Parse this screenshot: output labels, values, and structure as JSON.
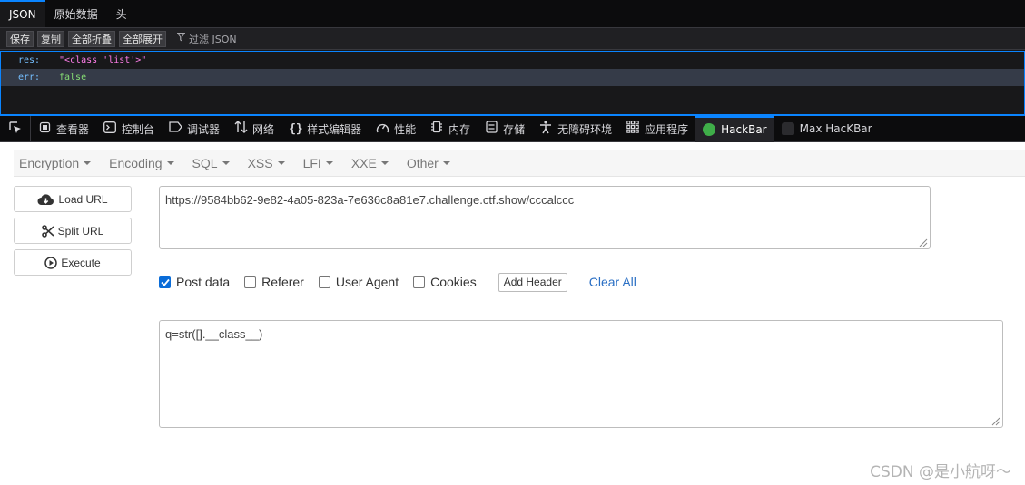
{
  "json_viewer": {
    "tabs": [
      "JSON",
      "原始数据",
      "头"
    ],
    "toolbar": [
      "保存",
      "复制",
      "全部折叠",
      "全部展开"
    ],
    "filter_placeholder": "过滤 JSON",
    "rows": [
      {
        "key": "res:",
        "value": "\"<class 'list'>\"",
        "type": "string"
      },
      {
        "key": "err:",
        "value": "false",
        "type": "boolean"
      }
    ]
  },
  "devtools": {
    "tabs": [
      {
        "label": "查看器",
        "icon": "inspector-icon"
      },
      {
        "label": "控制台",
        "icon": "console-icon"
      },
      {
        "label": "调试器",
        "icon": "debugger-icon"
      },
      {
        "label": "网络",
        "icon": "network-icon"
      },
      {
        "label": "样式编辑器",
        "icon": "style-editor-icon"
      },
      {
        "label": "性能",
        "icon": "performance-icon"
      },
      {
        "label": "内存",
        "icon": "memory-icon"
      },
      {
        "label": "存储",
        "icon": "storage-icon"
      },
      {
        "label": "无障碍环境",
        "icon": "accessibility-icon"
      },
      {
        "label": "应用程序",
        "icon": "application-icon"
      },
      {
        "label": "HackBar",
        "icon": "hackbar-icon",
        "active": true
      },
      {
        "label": "Max HacKBar",
        "icon": "max-hackbar-icon"
      }
    ]
  },
  "hackbar": {
    "menus": [
      "Encryption",
      "Encoding",
      "SQL",
      "XSS",
      "LFI",
      "XXE",
      "Other"
    ],
    "buttons": {
      "load": "Load URL",
      "split": "Split URL",
      "execute": "Execute"
    },
    "url": "https://9584bb62-9e82-4a05-823a-7e636c8a81e7.challenge.ctf.show/cccalccc",
    "checkboxes": [
      {
        "label": "Post data",
        "checked": true
      },
      {
        "label": "Referer",
        "checked": false
      },
      {
        "label": "User Agent",
        "checked": false
      },
      {
        "label": "Cookies",
        "checked": false
      }
    ],
    "add_header": "Add Header",
    "clear_all": "Clear All",
    "post_data": "q=str([].__class__)"
  },
  "watermark": "CSDN @是小航呀～",
  "colors": {
    "accent": "#0a84ff",
    "hackbar_green": "#3fae49",
    "link": "#2a6fc4"
  }
}
